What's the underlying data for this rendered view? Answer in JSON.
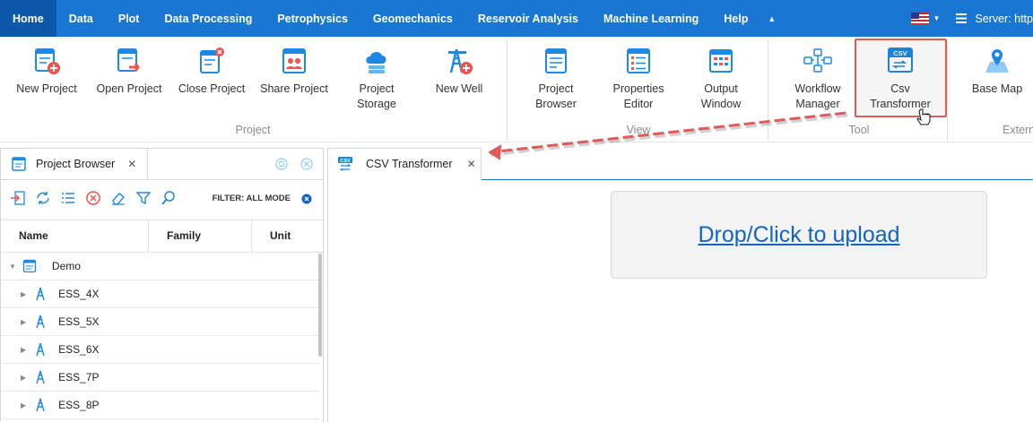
{
  "menubar": {
    "items": [
      "Home",
      "Data",
      "Plot",
      "Data Processing",
      "Petrophysics",
      "Geomechanics",
      "Reservoir Analysis",
      "Machine Learning",
      "Help"
    ],
    "active": "Home",
    "server_label": "Server: http"
  },
  "ribbon": {
    "buttons": [
      {
        "line1": "New Project",
        "line2": ""
      },
      {
        "line1": "Open Project",
        "line2": ""
      },
      {
        "line1": "Close Project",
        "line2": ""
      },
      {
        "line1": "Share Project",
        "line2": ""
      },
      {
        "line1": "Project",
        "line2": "Storage"
      },
      {
        "line1": "New Well",
        "line2": ""
      },
      {
        "line1": "Project",
        "line2": "Browser"
      },
      {
        "line1": "Properties",
        "line2": "Editor"
      },
      {
        "line1": "Output",
        "line2": "Window"
      },
      {
        "line1": "Workflow",
        "line2": "Manager"
      },
      {
        "line1": "Csv",
        "line2": "Transformer"
      },
      {
        "line1": "Base Map",
        "line2": ""
      }
    ],
    "groups": [
      "Project",
      "View",
      "Tool",
      "Extern"
    ]
  },
  "project_browser": {
    "tab_title": "Project Browser",
    "filter_label": "FILTER: ALL MODE",
    "columns": [
      "Name",
      "Family",
      "Unit"
    ],
    "root": "Demo",
    "wells": [
      "ESS_4X",
      "ESS_5X",
      "ESS_6X",
      "ESS_7P",
      "ESS_8P"
    ]
  },
  "csv_transformer": {
    "tab_title": "CSV Transformer",
    "upload_label": "Drop/Click to upload"
  },
  "colors": {
    "menubar": "#1976d2",
    "menubar_active": "#0d58a9",
    "icon_blue": "#1e88e5",
    "icon_red": "#ef5350",
    "highlight": "#e05a5a",
    "link": "#1565c0"
  }
}
